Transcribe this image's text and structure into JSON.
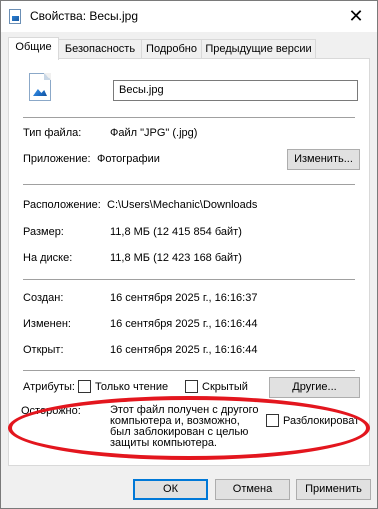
{
  "window": {
    "title": "Свойства: Весы.jpg",
    "close_glyph": "✕"
  },
  "tabs": [
    {
      "label": "Общие",
      "active": true
    },
    {
      "label": "Безопасность",
      "active": false
    },
    {
      "label": "Подробно",
      "active": false
    },
    {
      "label": "Предыдущие версии",
      "active": false
    }
  ],
  "file": {
    "name": "Весы.jpg",
    "icon": "jpg-file-icon"
  },
  "type": {
    "label": "Тип файла:",
    "value": "Файл \"JPG\" (.jpg)"
  },
  "app": {
    "label": "Приложение:",
    "value": "Фотографии",
    "change_button": "Изменить..."
  },
  "location": {
    "label": "Расположение:",
    "value": "C:\\Users\\Mechanic\\Downloads"
  },
  "size": {
    "label": "Размер:",
    "value": "11,8 МБ (12 415 854 байт)"
  },
  "disk": {
    "label": "На диске:",
    "value": "11,8 МБ (12 423 168 байт)"
  },
  "created": {
    "label": "Создан:",
    "value": "16 сентября 2025 г., 16:16:37"
  },
  "modified": {
    "label": "Изменен:",
    "value": "16 сентября 2025 г., 16:16:44"
  },
  "opened": {
    "label": "Открыт:",
    "value": "16 сентября 2025 г., 16:16:44"
  },
  "attributes": {
    "label": "Атрибуты:",
    "readonly_label": "Только чтение",
    "hidden_label": "Скрытый",
    "other_button": "Другие..."
  },
  "warning": {
    "label": "Осторожно:",
    "text": "Этот файл получен с другого компьютера и, возможно, был заблокирован с целью защиты компьютера.",
    "unblock_label": "Разблокироват"
  },
  "footer": {
    "ok": "ОК",
    "cancel": "Отмена",
    "apply": "Применить"
  },
  "colors": {
    "highlight_ring": "#e3161e",
    "default_button_border": "#0078d7"
  }
}
